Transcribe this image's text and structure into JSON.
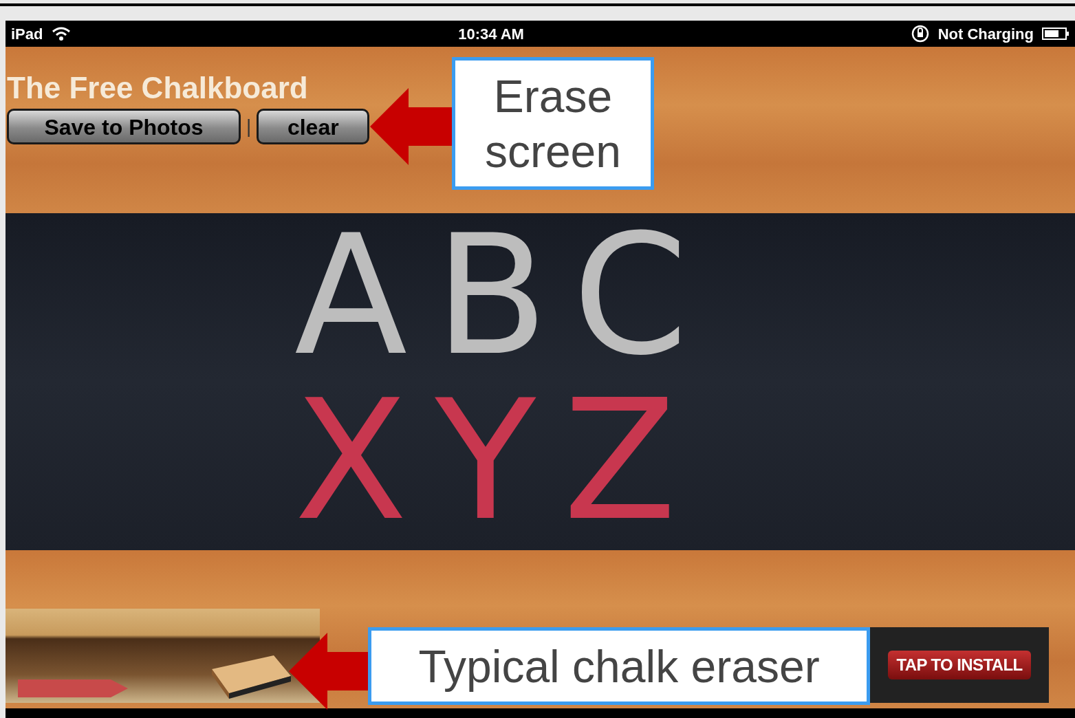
{
  "status_bar": {
    "device": "iPad",
    "time": "10:34 AM",
    "charging": "Not Charging"
  },
  "app": {
    "title": "The Free Chalkboard",
    "buttons": [
      "Save to Photos",
      "clear"
    ],
    "separator": "|"
  },
  "chalkboard": {
    "lines": [
      {
        "text": "ABC",
        "color": "#bdbdbd"
      },
      {
        "text": "XYZ",
        "color": "#c8374f"
      }
    ]
  },
  "ad": {
    "label": "TAP TO INSTALL"
  },
  "annotations": [
    {
      "text": "Erase screen"
    },
    {
      "text": "Typical chalk eraser"
    }
  ]
}
